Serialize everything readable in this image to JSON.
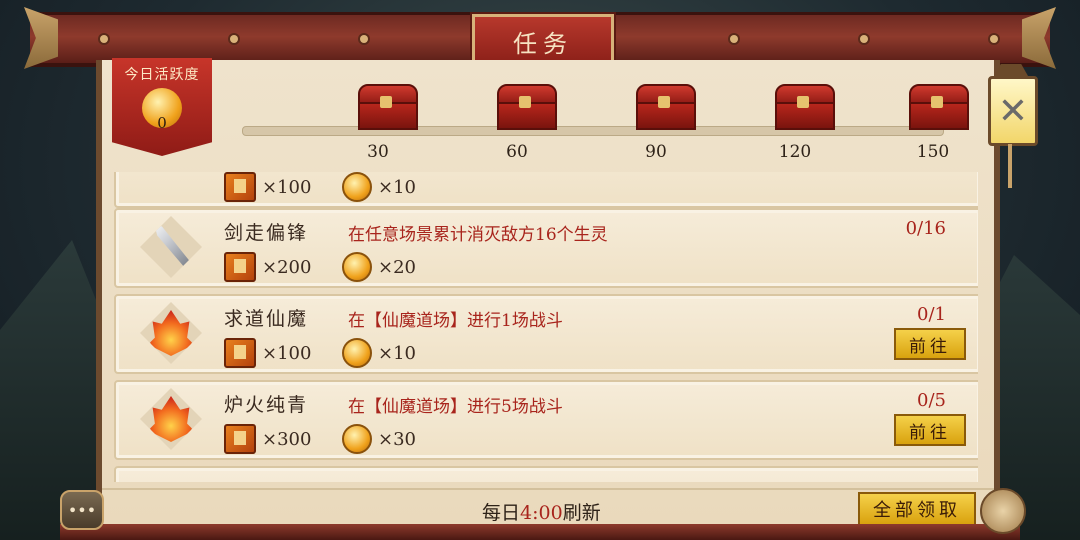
{
  "header": {
    "title": "任务"
  },
  "activity": {
    "label": "今日活跃度",
    "value": "0",
    "progress": 0,
    "milestones": [
      {
        "label": "30",
        "icon": "red-chest"
      },
      {
        "label": "60",
        "icon": "red-chest"
      },
      {
        "label": "90",
        "icon": "red-chest"
      },
      {
        "label": "120",
        "icon": "red-chest"
      },
      {
        "label": "150",
        "icon": "red-chest"
      }
    ]
  },
  "tasks": [
    {
      "name": "",
      "desc": "",
      "progress": "",
      "rewards": [
        {
          "icon": "book-icon",
          "amount": "×100"
        },
        {
          "icon": "coin-icon",
          "amount": "×10"
        }
      ],
      "icon": "partial"
    },
    {
      "name": "剑走偏锋",
      "desc": "在任意场景累计消灭敌方16个生灵",
      "progress": "0/16",
      "rewards": [
        {
          "icon": "book-icon",
          "amount": "×200"
        },
        {
          "icon": "coin-icon",
          "amount": "×20"
        }
      ],
      "icon": "sword-icon"
    },
    {
      "name": "求道仙魔",
      "desc": "在【仙魔道场】进行1场战斗",
      "progress": "0/1",
      "button": "前往",
      "rewards": [
        {
          "icon": "book-icon",
          "amount": "×100"
        },
        {
          "icon": "coin-icon",
          "amount": "×10"
        }
      ],
      "icon": "flame-icon"
    },
    {
      "name": "炉火纯青",
      "desc": "在【仙魔道场】进行5场战斗",
      "progress": "0/5",
      "button": "前往",
      "rewards": [
        {
          "icon": "book-icon",
          "amount": "×300"
        },
        {
          "icon": "coin-icon",
          "amount": "×30"
        }
      ],
      "icon": "flame-icon"
    }
  ],
  "footer": {
    "refresh_prefix": "每日",
    "refresh_time": "4:00",
    "refresh_suffix": "刷新",
    "claim_all": "全部领取"
  },
  "side": {
    "close_symbol": "✕",
    "chat_symbol": "•••"
  },
  "colors": {
    "accent_red": "#a8241c",
    "gold_button": "#f5d14a",
    "beam": "#8e3a2c"
  }
}
